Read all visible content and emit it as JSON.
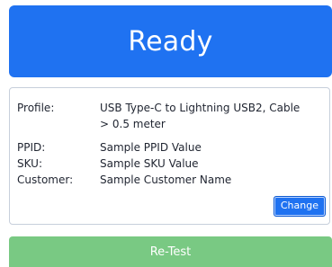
{
  "status": {
    "title": "Ready"
  },
  "details": {
    "profile_label": "Profile:",
    "profile_value_line_1": "USB Type-C to Lightning USB2, Cable",
    "profile_value_line_2": "> 0.5 meter",
    "ppid_label": "PPID:",
    "ppid_value": "Sample PPID Value",
    "sku_label": "SKU:",
    "sku_value": "Sample SKU Value",
    "customer_label": "Customer:",
    "customer_value": "Sample Customer Name",
    "change_button": "Change"
  },
  "actions": {
    "retest_label": "Re-Test"
  },
  "colors": {
    "status_blue": "#1f72f1",
    "retest_green": "#79c983",
    "card_border": "#c7cfdb"
  }
}
